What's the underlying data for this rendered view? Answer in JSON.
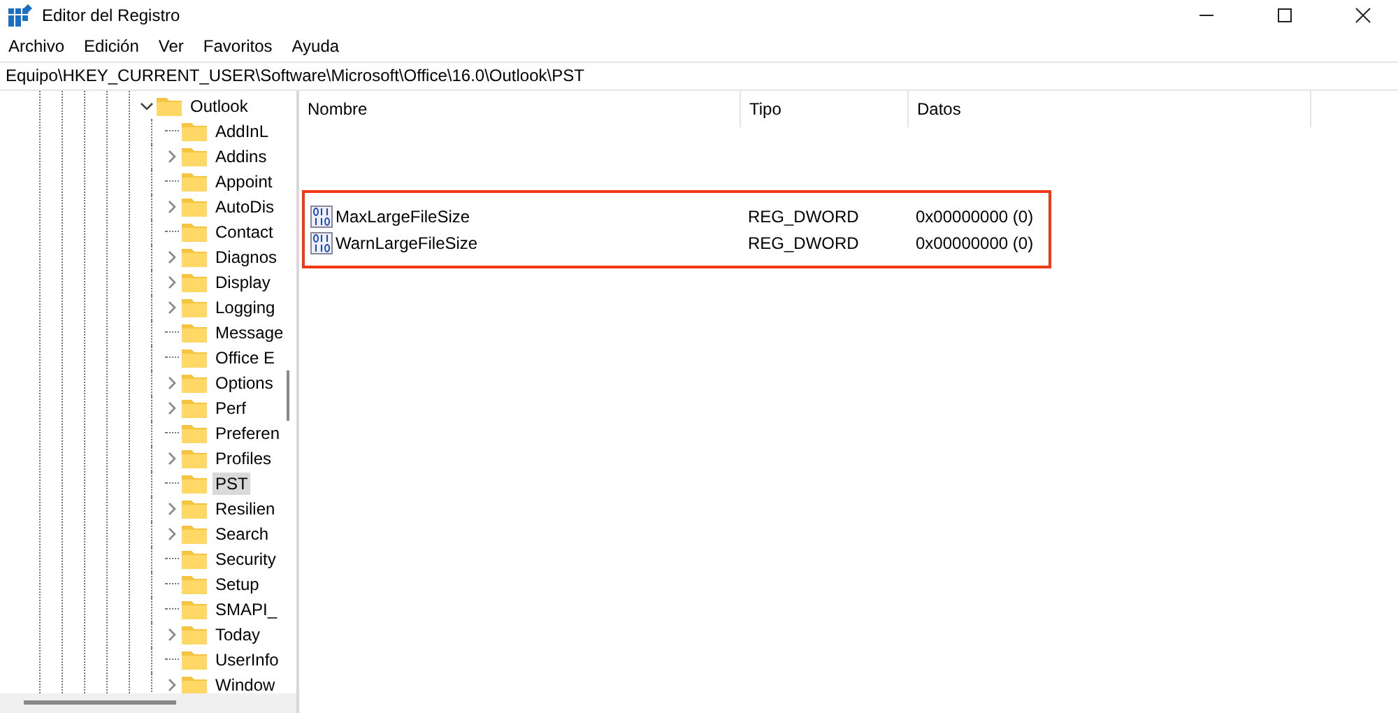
{
  "window": {
    "title": "Editor del Registro"
  },
  "menu": [
    "Archivo",
    "Edición",
    "Ver",
    "Favoritos",
    "Ayuda"
  ],
  "address": "Equipo\\HKEY_CURRENT_USER\\Software\\Microsoft\\Office\\16.0\\Outlook\\PST",
  "tree": {
    "name": "Outlook",
    "expanded": true,
    "children": [
      {
        "name": "AddInL",
        "has_children": false,
        "selected": false
      },
      {
        "name": "Addins",
        "has_children": true,
        "selected": false
      },
      {
        "name": "Appoint",
        "has_children": false,
        "selected": false
      },
      {
        "name": "AutoDis",
        "has_children": true,
        "selected": false
      },
      {
        "name": "Contact",
        "has_children": false,
        "selected": false
      },
      {
        "name": "Diagnos",
        "has_children": true,
        "selected": false
      },
      {
        "name": "Display",
        "has_children": true,
        "selected": false
      },
      {
        "name": "Logging",
        "has_children": true,
        "selected": false
      },
      {
        "name": "Message",
        "has_children": false,
        "selected": false
      },
      {
        "name": "Office E",
        "has_children": false,
        "selected": false
      },
      {
        "name": "Options",
        "has_children": true,
        "selected": false
      },
      {
        "name": "Perf",
        "has_children": true,
        "selected": false
      },
      {
        "name": "Preferen",
        "has_children": false,
        "selected": false
      },
      {
        "name": "Profiles",
        "has_children": true,
        "selected": false
      },
      {
        "name": "PST",
        "has_children": false,
        "selected": true
      },
      {
        "name": "Resilien",
        "has_children": true,
        "selected": false
      },
      {
        "name": "Search",
        "has_children": true,
        "selected": false
      },
      {
        "name": "Security",
        "has_children": false,
        "selected": false
      },
      {
        "name": "Setup",
        "has_children": false,
        "selected": false
      },
      {
        "name": "SMAPI_",
        "has_children": false,
        "selected": false
      },
      {
        "name": "Today",
        "has_children": true,
        "selected": false
      },
      {
        "name": "UserInfo",
        "has_children": false,
        "selected": false
      },
      {
        "name": "Window",
        "has_children": true,
        "selected": false
      }
    ]
  },
  "values": {
    "columns": [
      "Nombre",
      "Tipo",
      "Datos"
    ],
    "rows": [
      {
        "name": "MaxLargeFileSize",
        "type": "REG_DWORD",
        "data": "0x00000000 (0)",
        "highlighted": true
      },
      {
        "name": "WarnLargeFileSize",
        "type": "REG_DWORD",
        "data": "0x00000000 (0)",
        "highlighted": true
      }
    ]
  }
}
